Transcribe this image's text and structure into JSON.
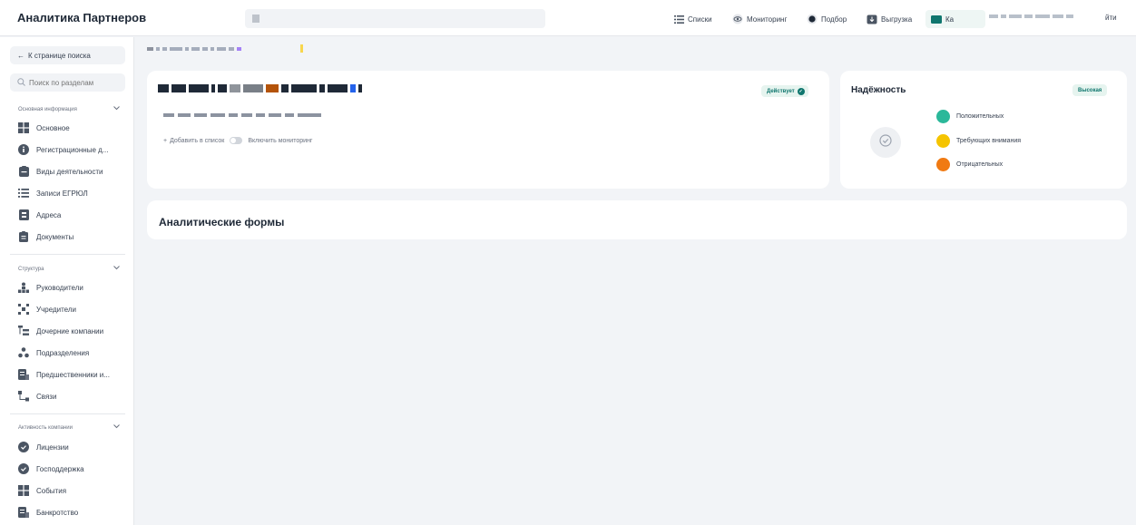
{
  "app": {
    "title": "Аналитика Партнеров"
  },
  "topnav": {
    "lists": "Списки",
    "monitoring": "Мониторинг",
    "selection": "Подбор",
    "export": "Выгрузка",
    "card": "Ка",
    "logout": "йти"
  },
  "sidebar": {
    "back": "К странице поиска",
    "search_placeholder": "Поиск по разделам",
    "sections": [
      {
        "title": "Основная информация",
        "items": [
          {
            "label": "Основное",
            "icon": "grid-icon"
          },
          {
            "label": "Регистрационные д...",
            "icon": "info-icon"
          },
          {
            "label": "Виды деятельности",
            "icon": "briefcase-icon"
          },
          {
            "label": "Записи ЕГРЮЛ",
            "icon": "list-icon"
          },
          {
            "label": "Адреса",
            "icon": "address-icon"
          },
          {
            "label": "Документы",
            "icon": "document-icon"
          }
        ]
      },
      {
        "title": "Структура",
        "items": [
          {
            "label": "Руководители",
            "icon": "people-icon"
          },
          {
            "label": "Учредители",
            "icon": "founders-icon"
          },
          {
            "label": "Дочерние компании",
            "icon": "subsidiaries-icon"
          },
          {
            "label": "Подразделения",
            "icon": "divisions-icon"
          },
          {
            "label": "Предшественники и...",
            "icon": "predecessors-icon"
          },
          {
            "label": "Связи",
            "icon": "links-icon"
          }
        ]
      },
      {
        "title": "Активность компании",
        "items": [
          {
            "label": "Лицензии",
            "icon": "license-icon"
          },
          {
            "label": "Господдержка",
            "icon": "support-icon"
          },
          {
            "label": "События",
            "icon": "events-icon"
          },
          {
            "label": "Банкротство",
            "icon": "bankruptcy-icon"
          }
        ]
      }
    ]
  },
  "company": {
    "status": "Действует",
    "add_to_list": "Добавить в список",
    "monitoring_toggle": "Включить мониторинг"
  },
  "reliability": {
    "title": "Надёжность",
    "level": "Высокая",
    "legend": [
      {
        "label": "Положительных",
        "color": "#2bb89a"
      },
      {
        "label": "Требующих внимания",
        "color": "#f5c400"
      },
      {
        "label": "Отрицательных",
        "color": "#f07a12"
      }
    ]
  },
  "forms": {
    "title": "Аналитические формы"
  },
  "colors": {
    "accent": "#0f766e",
    "status_bg": "#e6f4ef"
  }
}
